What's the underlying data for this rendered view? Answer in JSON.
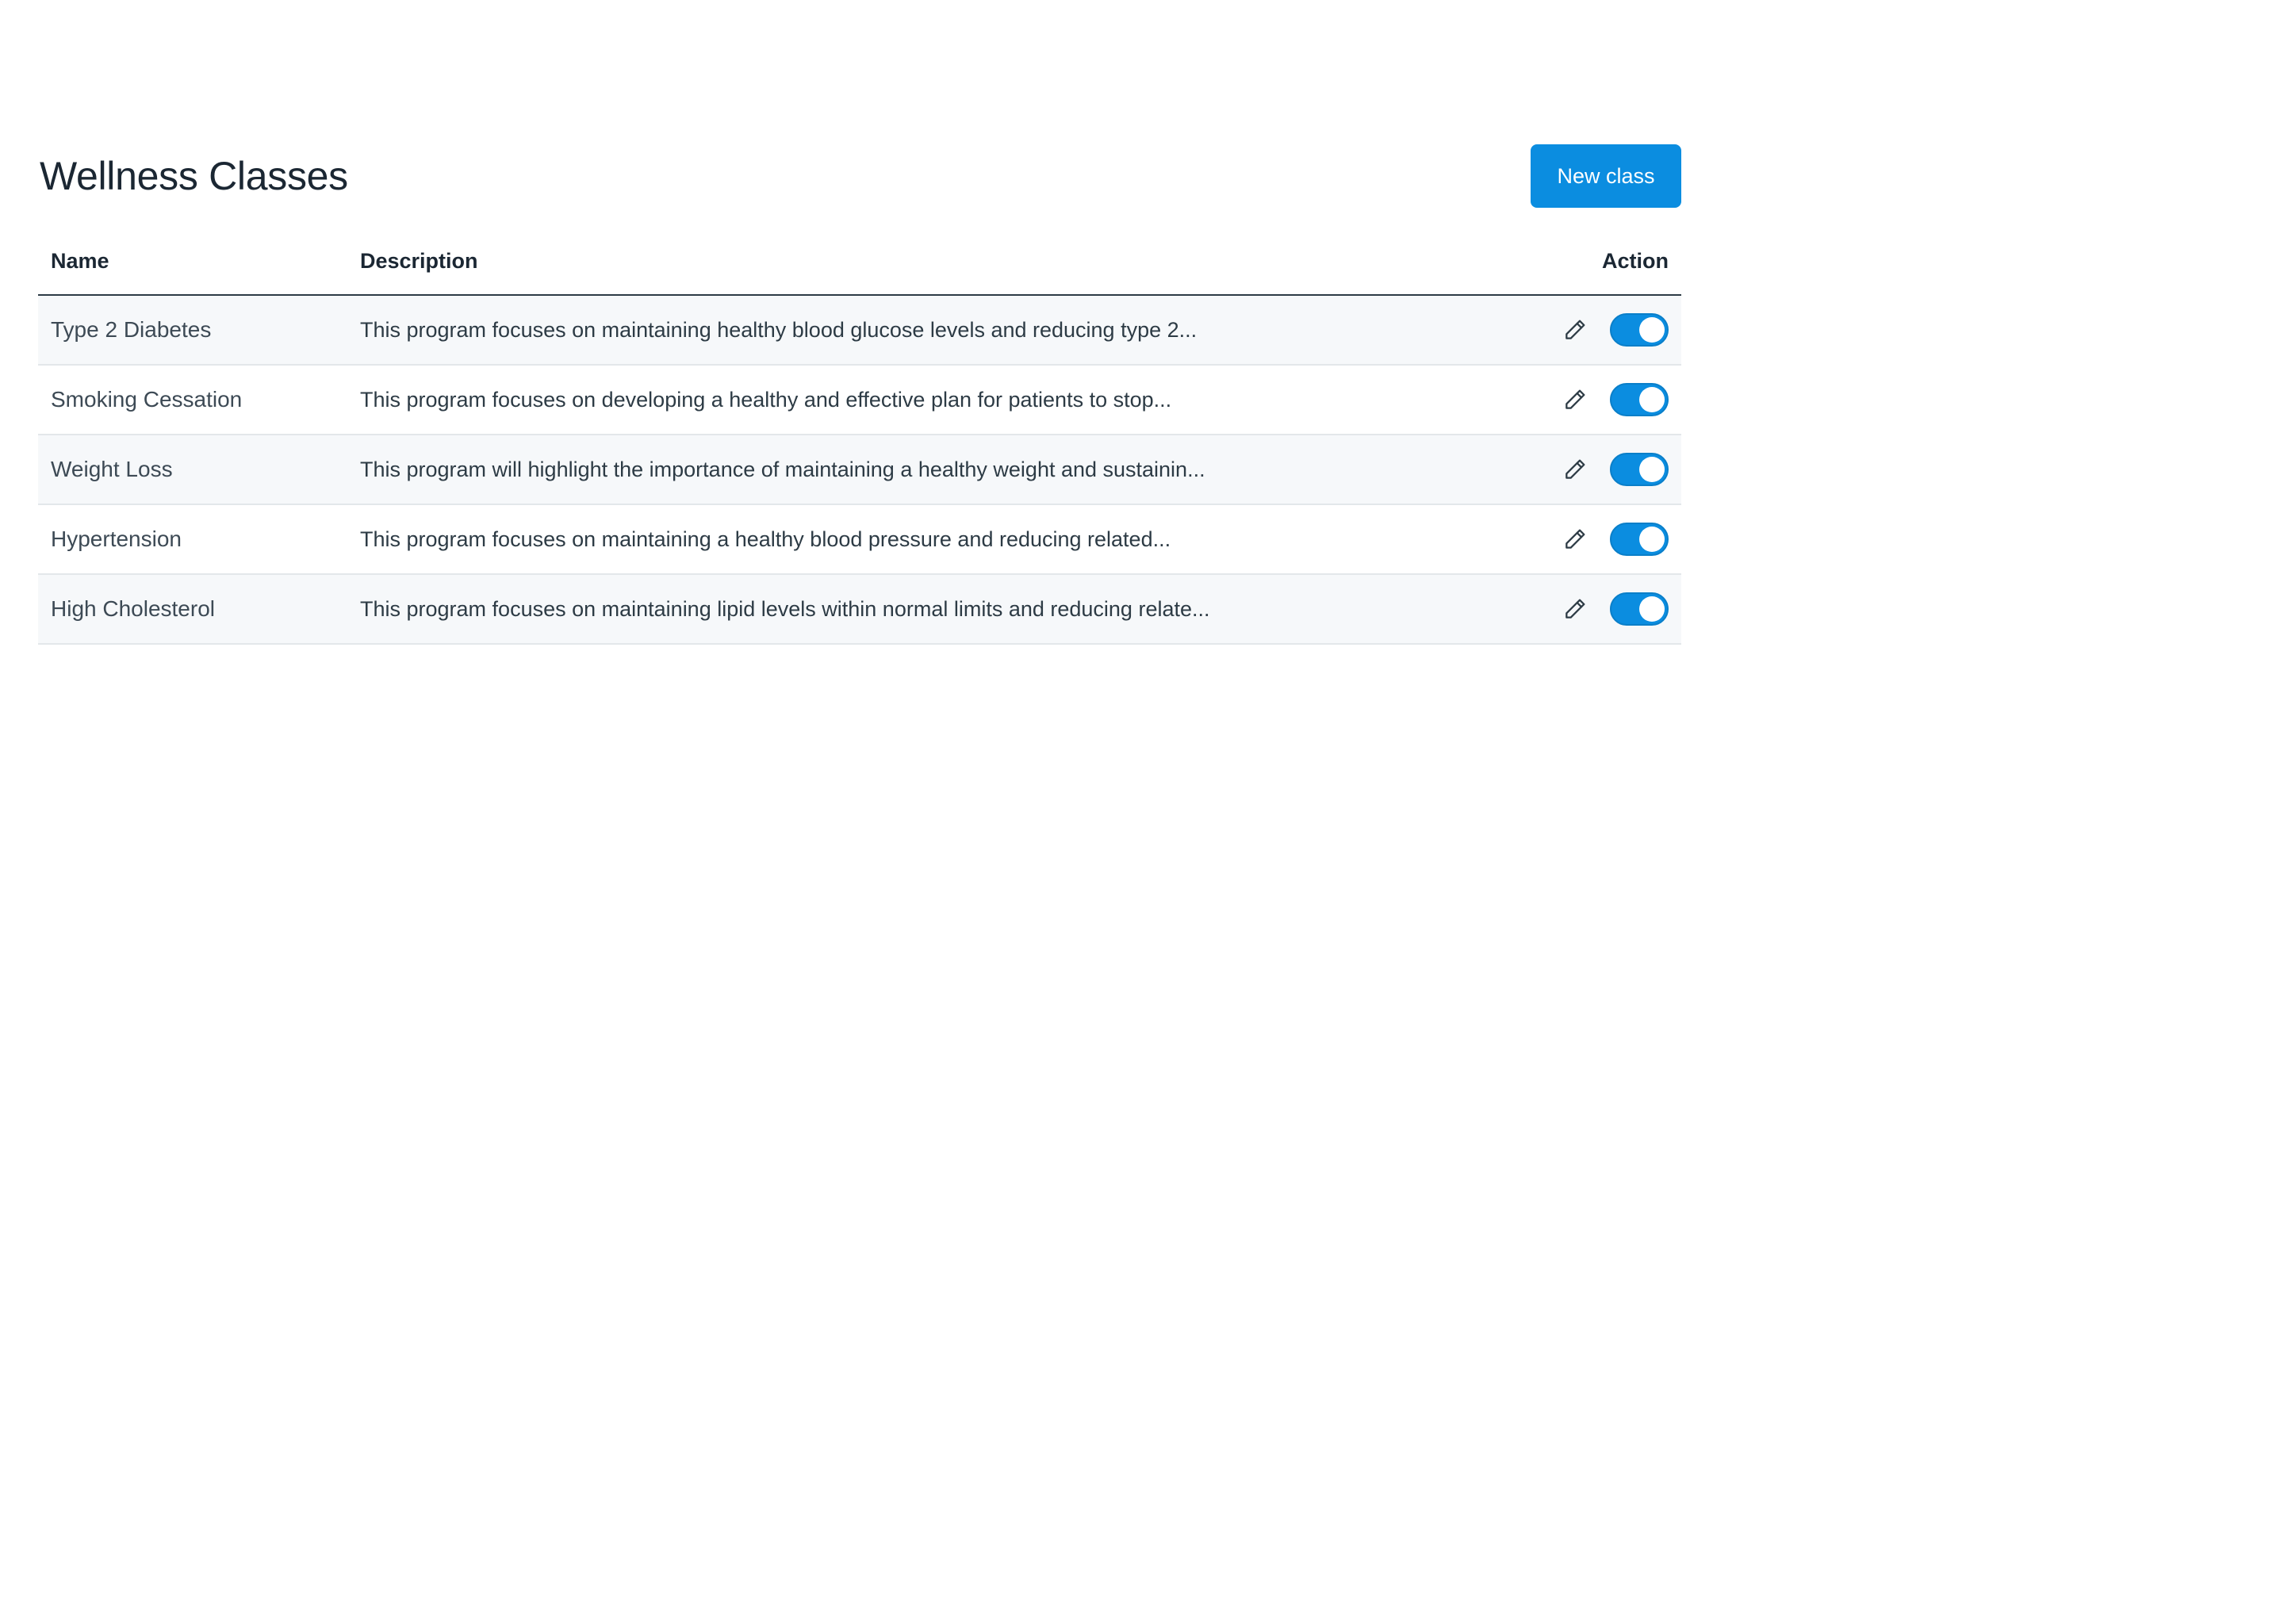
{
  "page": {
    "title": "Wellness Classes",
    "new_button_label": "New class"
  },
  "colors": {
    "accent": "#0b8de0",
    "text_dark": "#1b2733",
    "row_stripe": "#f6f8fa"
  },
  "table": {
    "columns": {
      "name": "Name",
      "description": "Description",
      "action": "Action"
    },
    "rows": [
      {
        "name": "Type 2 Diabetes",
        "description": "This program focuses on maintaining healthy blood glucose levels and reducing type 2...",
        "enabled": true,
        "edit_icon": "pencil-icon"
      },
      {
        "name": "Smoking Cessation",
        "description": "This program focuses on developing a healthy and effective plan for patients to stop...",
        "enabled": true,
        "edit_icon": "pencil-icon"
      },
      {
        "name": "Weight Loss",
        "description": "This program will highlight the importance of maintaining a healthy weight and sustainin...",
        "enabled": true,
        "edit_icon": "pencil-icon"
      },
      {
        "name": "Hypertension",
        "description": "This program focuses on maintaining a healthy blood pressure and reducing related...",
        "enabled": true,
        "edit_icon": "pencil-icon"
      },
      {
        "name": "High Cholesterol",
        "description": "This program focuses on maintaining lipid levels within normal limits and reducing relate...",
        "enabled": true,
        "edit_icon": "pencil-icon"
      }
    ]
  }
}
